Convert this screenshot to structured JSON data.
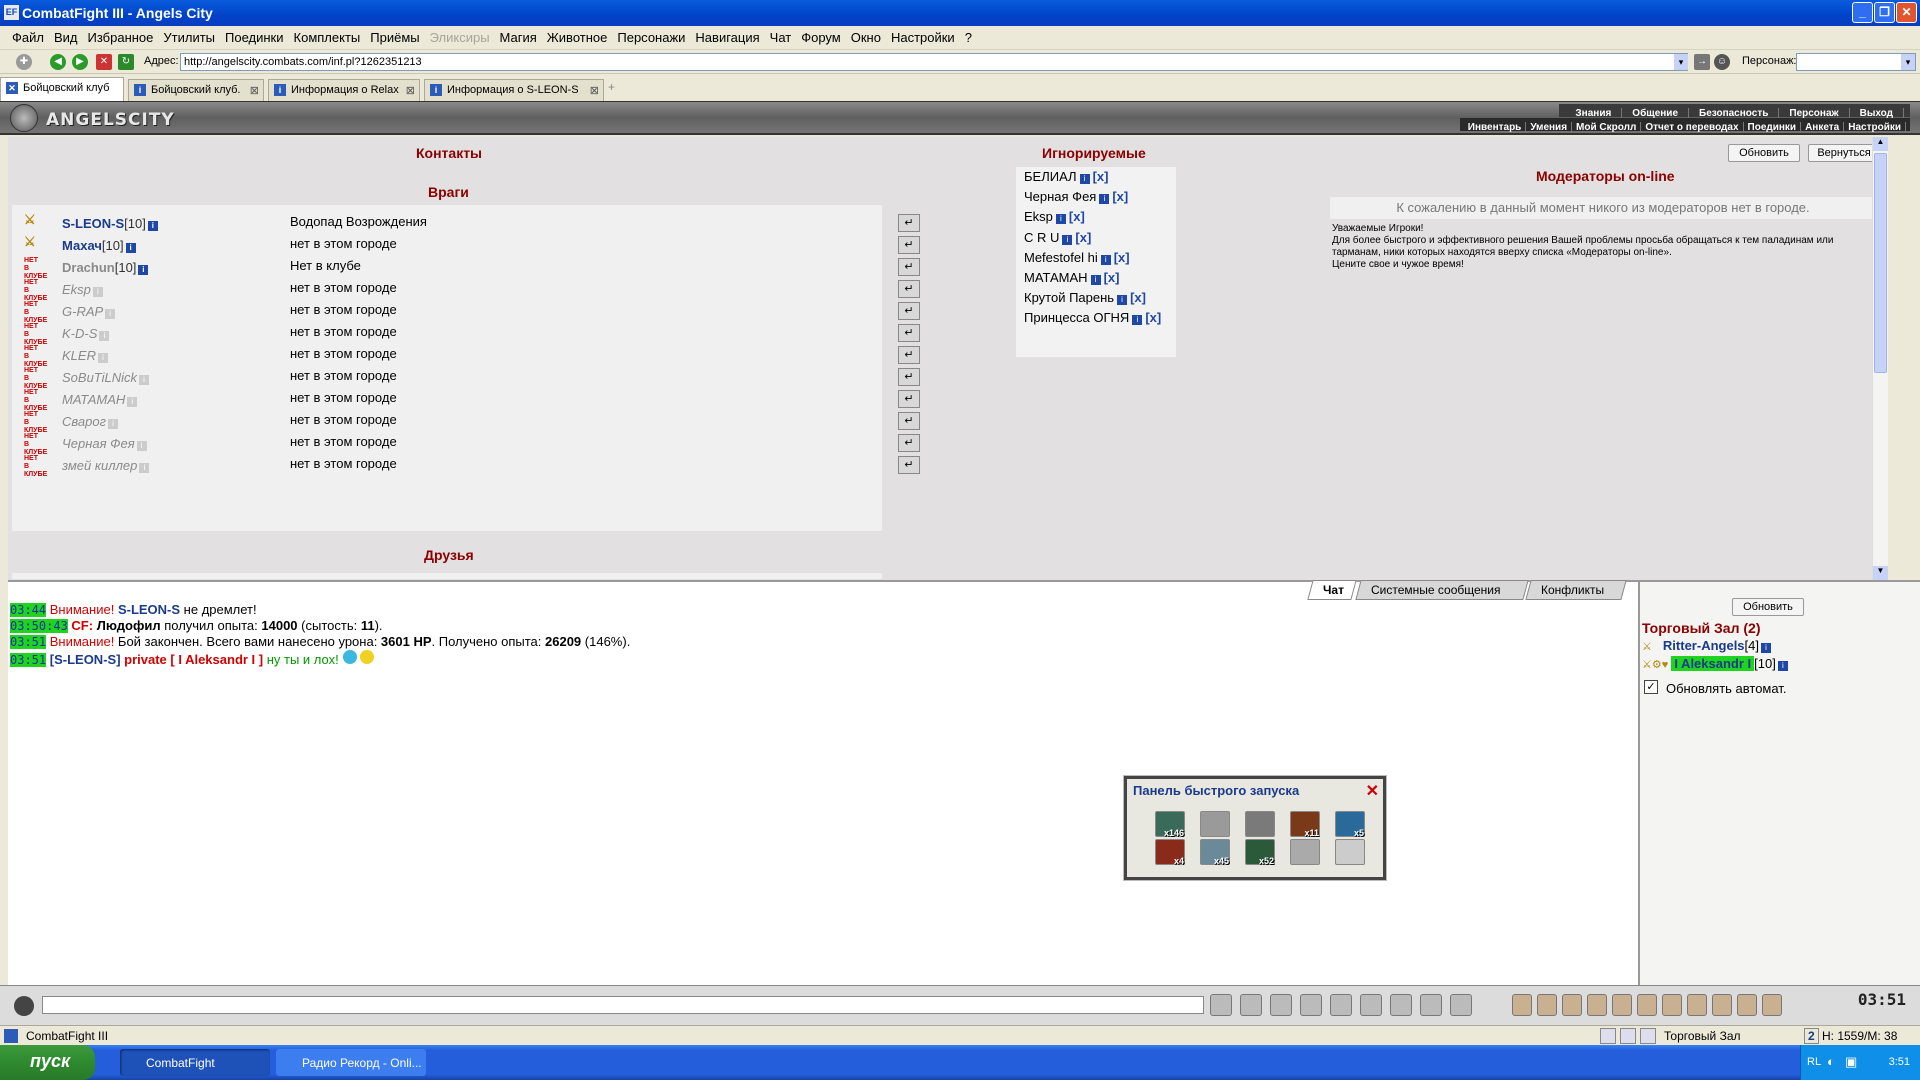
{
  "window": {
    "title": "CombatFight III - Angels City",
    "app_icon": "EF"
  },
  "menu": [
    {
      "label": "Файл",
      "disabled": false
    },
    {
      "label": "Вид",
      "disabled": false
    },
    {
      "label": "Избранное",
      "disabled": false
    },
    {
      "label": "Утилиты",
      "disabled": false
    },
    {
      "label": "Поединки",
      "disabled": false
    },
    {
      "label": "Комплекты",
      "disabled": false
    },
    {
      "label": "Приёмы",
      "disabled": false
    },
    {
      "label": "Эликсиры",
      "disabled": true
    },
    {
      "label": "Магия",
      "disabled": false
    },
    {
      "label": "Животное",
      "disabled": false
    },
    {
      "label": "Персонажи",
      "disabled": false
    },
    {
      "label": "Навигация",
      "disabled": false
    },
    {
      "label": "Чат",
      "disabled": false
    },
    {
      "label": "Форум",
      "disabled": false
    },
    {
      "label": "Окно",
      "disabled": false
    },
    {
      "label": "Настройки",
      "disabled": false
    },
    {
      "label": "?",
      "disabled": false
    }
  ],
  "address": {
    "label": "Адрес:",
    "url": "http://angelscity.combats.com/inf.pl?1262351213",
    "persona_label": "Персонаж:"
  },
  "tabs": [
    {
      "label": "Бойцовский клуб",
      "active": true
    },
    {
      "label": "Бойцовский клуб.",
      "active": false
    },
    {
      "label": "Информация о Relax",
      "active": false
    },
    {
      "label": "Информация о S-LEON-S",
      "active": false
    }
  ],
  "game_header": {
    "logo": "ANGELSCITY",
    "nav_top": [
      "Знания",
      "Общение",
      "Безопасность",
      "Персонаж",
      "Выход"
    ],
    "nav_bottom": [
      "Инвентарь",
      "Умения",
      "Мой Скролл",
      "Отчет о переводах",
      "Поединки",
      "Анкета",
      "Настройки"
    ]
  },
  "contacts": {
    "title": "Контакты",
    "enemies_title": "Враги",
    "friends_title": "Друзья",
    "enemies": [
      {
        "name": "S-LEON-S",
        "level": "[10]",
        "location": "Водопад Возрождения",
        "online": true
      },
      {
        "name": "Махач",
        "level": "[10]",
        "location": "нет в этом городе",
        "online": true
      },
      {
        "name": "Drachun",
        "level": "[10]",
        "location": "Нет в клубе",
        "online": false,
        "level_shown": true
      },
      {
        "name": "Eksp",
        "level": "",
        "location": "нет в этом городе",
        "online": false
      },
      {
        "name": "G-RAP",
        "level": "",
        "location": "нет в этом городе",
        "online": false
      },
      {
        "name": "K-D-S",
        "level": "",
        "location": "нет в этом городе",
        "online": false
      },
      {
        "name": "KLER",
        "level": "",
        "location": "нет в этом городе",
        "online": false
      },
      {
        "name": "SoBuTiLNick",
        "level": "",
        "location": "нет в этом городе",
        "online": false
      },
      {
        "name": "МАТАМАН",
        "level": "",
        "location": "нет в этом городе",
        "online": false
      },
      {
        "name": "Сварог",
        "level": "",
        "location": "нет в этом городе",
        "online": false
      },
      {
        "name": "Черная Фея",
        "level": "",
        "location": "нет в этом городе",
        "online": false
      },
      {
        "name": "змей киллер",
        "level": "",
        "location": "нет в этом городе",
        "online": false
      }
    ],
    "offline_badge": "НЕТ В КЛУБЕ"
  },
  "ignored": {
    "title": "Игнорируемые",
    "items": [
      "БЕЛИАЛ",
      "Черная Фея",
      "Eksp",
      "C R U",
      "Mefestofel hi",
      "МАТАМАН",
      "Крутой Парень",
      "Принцесса ОГНЯ"
    ],
    "remove_label": "[x]"
  },
  "moderators": {
    "title": "Модераторы on-line",
    "empty": "К сожалению в данный момент никого из модераторов нет в городе.",
    "note": "Уважаемые Игроки!\nДля более быстрого и эффективного решения Вашей проблемы просьба обращаться к тем паладинам или тарманам, ники которых находятся вверху списка «Модераторы on-line».\nЦените свое и чужое время!"
  },
  "buttons": {
    "refresh": "Обновить",
    "back": "Вернуться"
  },
  "chat": {
    "tabs": [
      "Чат",
      "Системные сообщения",
      "Конфликты"
    ],
    "lines": [
      {
        "time": "03:44",
        "parts": [
          {
            "t": "Внимание!",
            "c": "red"
          },
          {
            "t": " "
          },
          {
            "t": "S-LEON-S",
            "c": "blue"
          },
          {
            "t": " не дремлет!"
          }
        ]
      },
      {
        "time": "03:50:43",
        "parts": [
          {
            "t": "CF:",
            "c": "redb"
          },
          {
            "t": " "
          },
          {
            "t": "Людофил",
            "c": "bold"
          },
          {
            "t": " получил опыта: "
          },
          {
            "t": "14000",
            "c": "bold"
          },
          {
            "t": " (сытость: "
          },
          {
            "t": "11",
            "c": "bold"
          },
          {
            "t": ")."
          }
        ]
      },
      {
        "time": "03:51",
        "parts": [
          {
            "t": "Внимание!",
            "c": "red"
          },
          {
            "t": " Бой закончен. Всего вами нанесено урона: "
          },
          {
            "t": "3601 HP",
            "c": "bold"
          },
          {
            "t": ". Получено опыта: "
          },
          {
            "t": "26209",
            "c": "bold"
          },
          {
            "t": " (146%)."
          }
        ]
      },
      {
        "time": "03:51",
        "parts": [
          {
            "t": "[S-LEON-S]",
            "c": "blue"
          },
          {
            "t": " "
          },
          {
            "t": "private [ I Aleksandr I ]",
            "c": "redb"
          },
          {
            "t": " "
          },
          {
            "t": "ну ты и лох!",
            "c": "green"
          }
        ]
      }
    ]
  },
  "side": {
    "refresh": "Обновить",
    "room": "Торговый Зал (2)",
    "users": [
      {
        "name": "Ritter-Angels",
        "level": "[4]"
      },
      {
        "name": "I Aleksandr I",
        "level": "[10]"
      }
    ],
    "auto_refresh": "Обновлять автомат."
  },
  "quick_panel": {
    "title": "Панель быстрого запуска",
    "slots": [
      {
        "count": "x146",
        "color": "#3a6a5a"
      },
      {
        "count": "",
        "color": "#9a9a9a"
      },
      {
        "count": "",
        "color": "#7a7a7a"
      },
      {
        "count": "x11",
        "color": "#7a3a1a"
      },
      {
        "count": "x5",
        "color": "#2a6a9a"
      },
      {
        "count": "x4",
        "color": "#8a2a1a"
      },
      {
        "count": "x45",
        "color": "#6a8a9a"
      },
      {
        "count": "x52",
        "color": "#2a5a3a"
      },
      {
        "count": "",
        "color": "#aaaaaa"
      },
      {
        "count": "",
        "color": "#cccccc"
      }
    ]
  },
  "bottom": {
    "clock": "03:51"
  },
  "status": {
    "left": "CombatFight III",
    "room": "Торговый Зал",
    "hp": "H: 1559/M: 38",
    "num": "2"
  },
  "taskbar": {
    "start": "пуск",
    "items": [
      "CombatFight",
      "Радио Рекорд - Onli..."
    ],
    "lang": "RL",
    "time": "3:51"
  }
}
